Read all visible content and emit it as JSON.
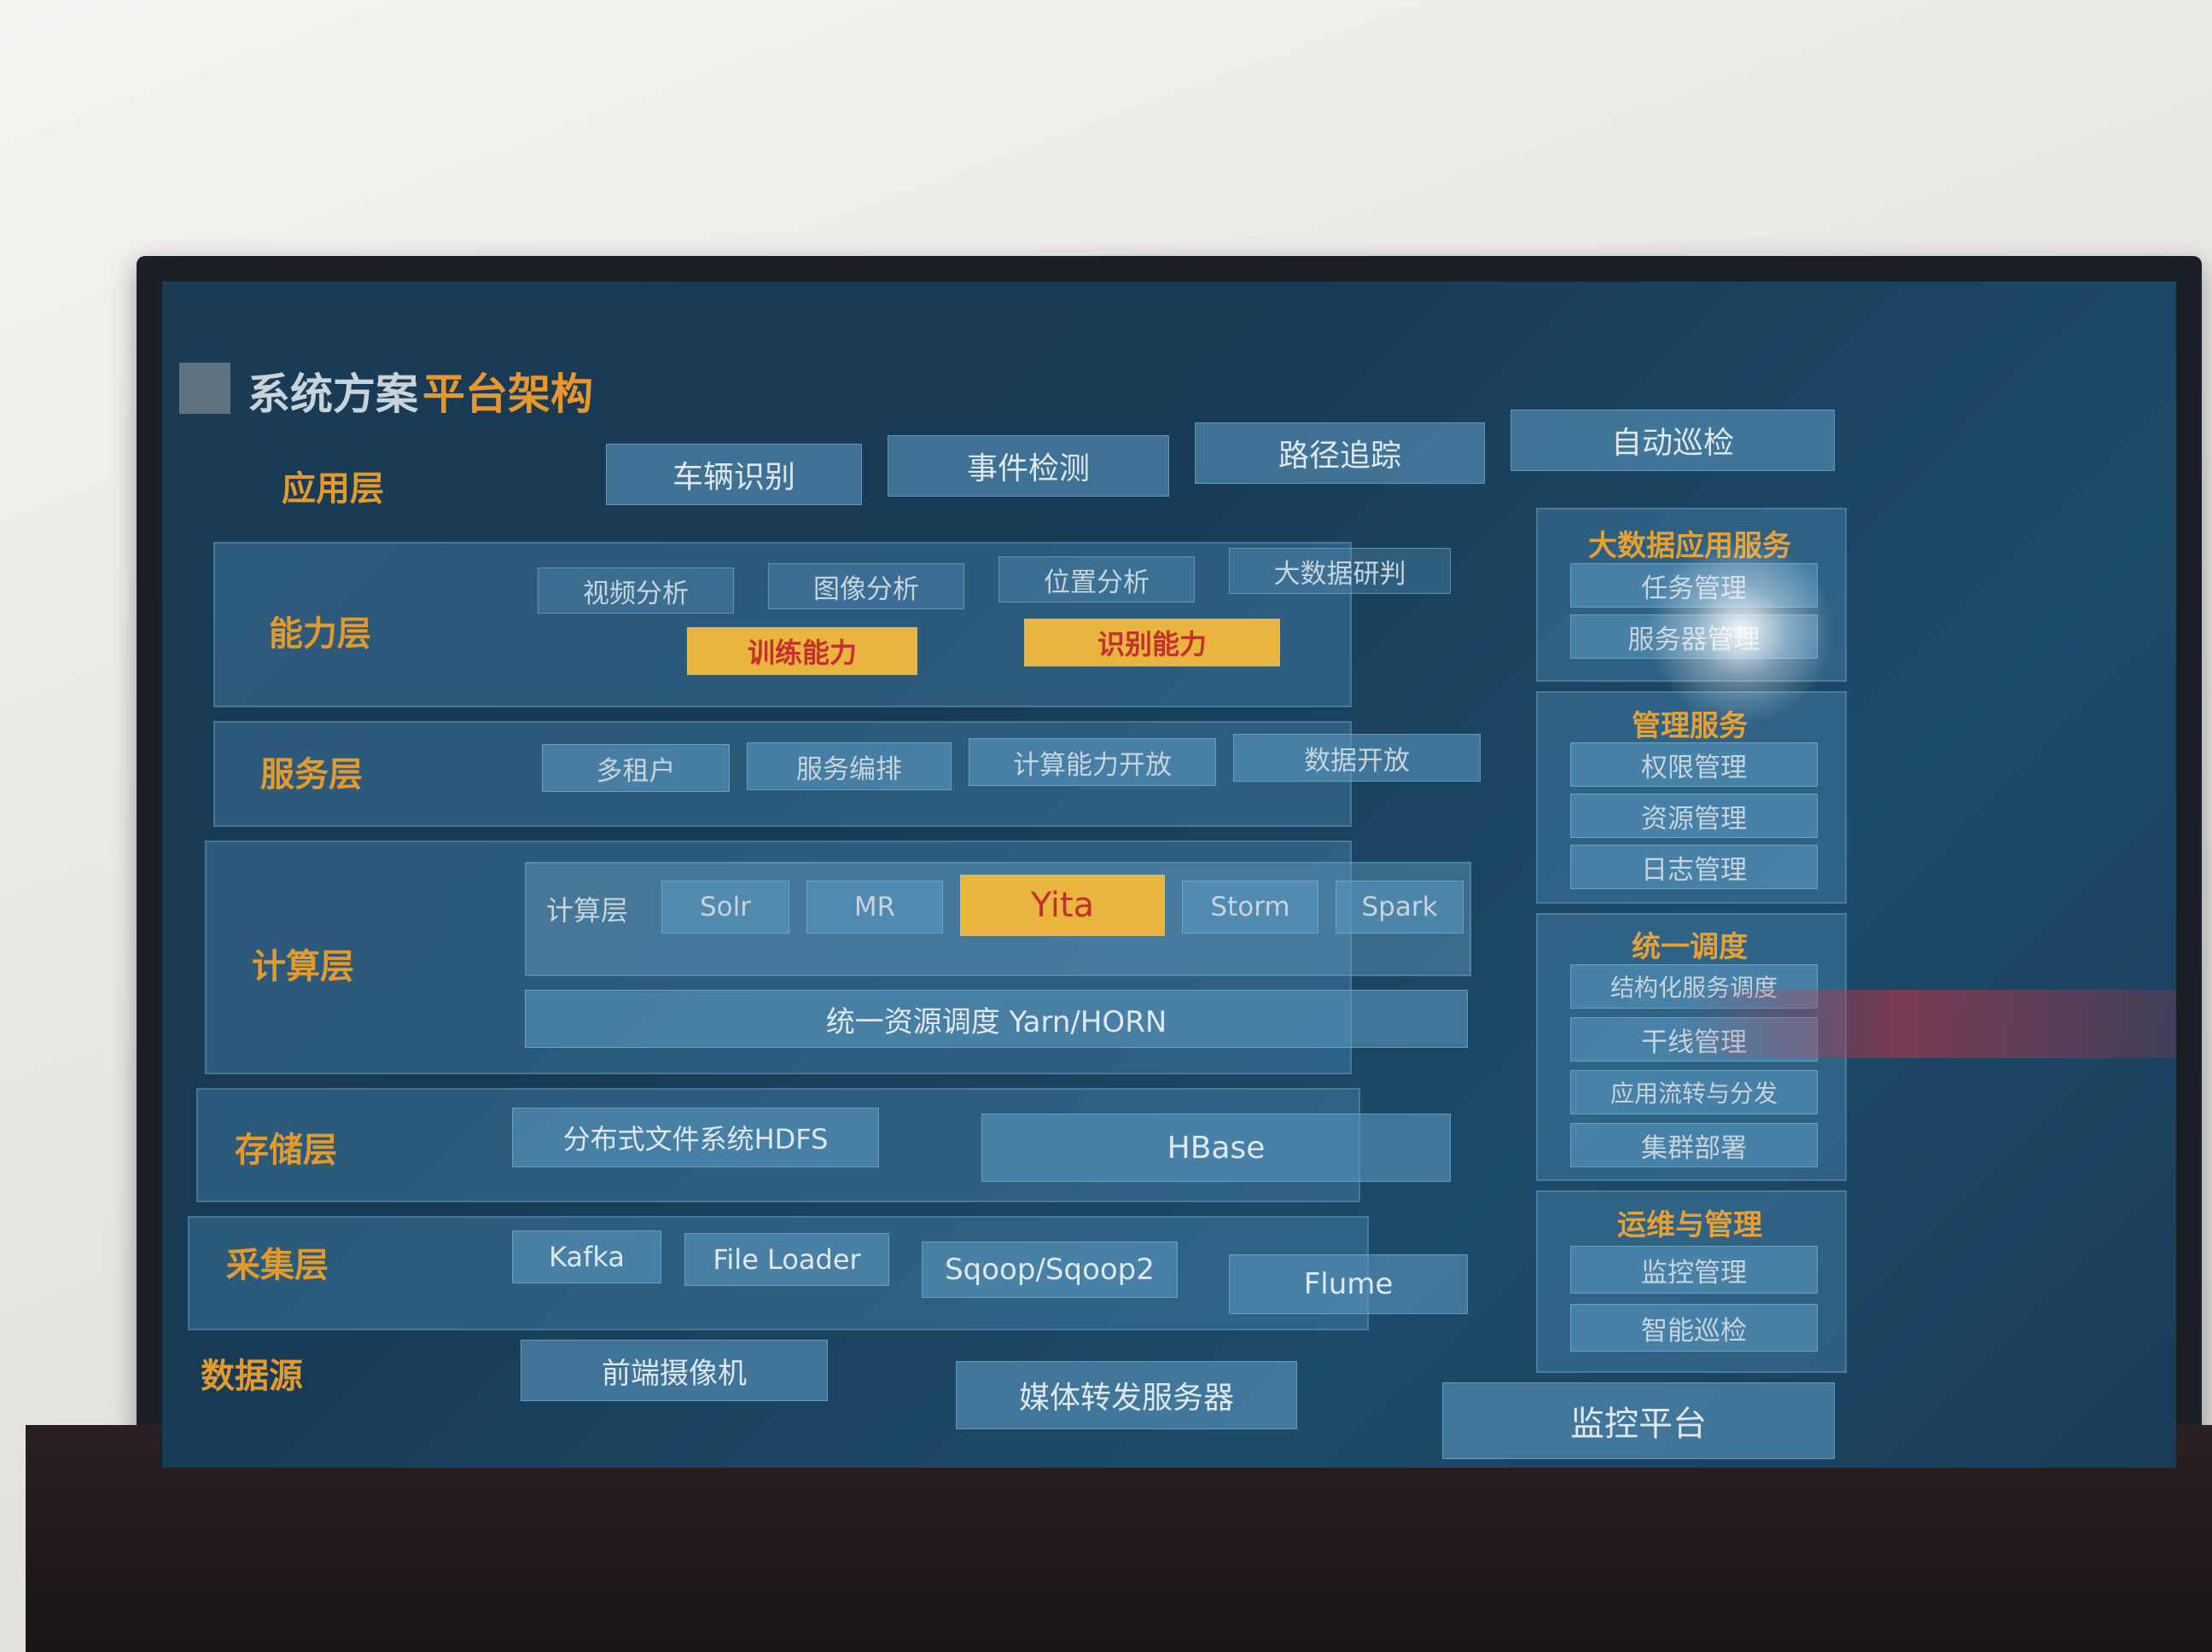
{
  "header": {
    "title_main": "系统方案",
    "title_sub": "平台架构"
  },
  "layers": {
    "application": {
      "label": "应用层",
      "items": [
        "车辆识别",
        "事件检测",
        "路径追踪",
        "自动巡检"
      ]
    },
    "capability": {
      "label": "能力层",
      "items": [
        "视频分析",
        "图像分析",
        "位置分析",
        "大数据研判"
      ],
      "highlights": [
        "训练能力",
        "识别能力"
      ]
    },
    "service": {
      "label": "服务层",
      "items": [
        "多租户",
        "服务编排",
        "计算能力开放",
        "数据开放"
      ]
    },
    "compute": {
      "label": "计算层",
      "inner_label": "计算层",
      "items": [
        "Solr",
        "MR",
        "Yita",
        "Storm",
        "Spark"
      ],
      "scheduler": "统一资源调度 Yarn/HORN"
    },
    "storage": {
      "label": "存储层",
      "items": [
        "分布式文件系统HDFS",
        "HBase"
      ]
    },
    "collection": {
      "label": "采集层",
      "items": [
        "Kafka",
        "File Loader",
        "Sqoop/Sqoop2",
        "Flume"
      ]
    },
    "datasource": {
      "label": "数据源",
      "items": [
        "前端摄像机",
        "媒体转发服务器",
        "监控平台"
      ]
    }
  },
  "side_panels": [
    {
      "title": "大数据应用服务",
      "items": [
        "任务管理",
        "服务器管理"
      ]
    },
    {
      "title": "管理服务",
      "items": [
        "权限管理",
        "资源管理",
        "日志管理"
      ]
    },
    {
      "title": "统一调度",
      "items": [
        "结构化服务调度",
        "干线管理",
        "应用流转与分发",
        "集群部署"
      ]
    },
    {
      "title": "运维与管理",
      "items": [
        "监控管理",
        "智能巡检"
      ]
    }
  ],
  "colors": {
    "accent_orange": "#e39a2c",
    "highlight_yellow": "#e9b53e",
    "highlight_text_red": "#c4302c",
    "screen_blue": "#1a3b55"
  }
}
